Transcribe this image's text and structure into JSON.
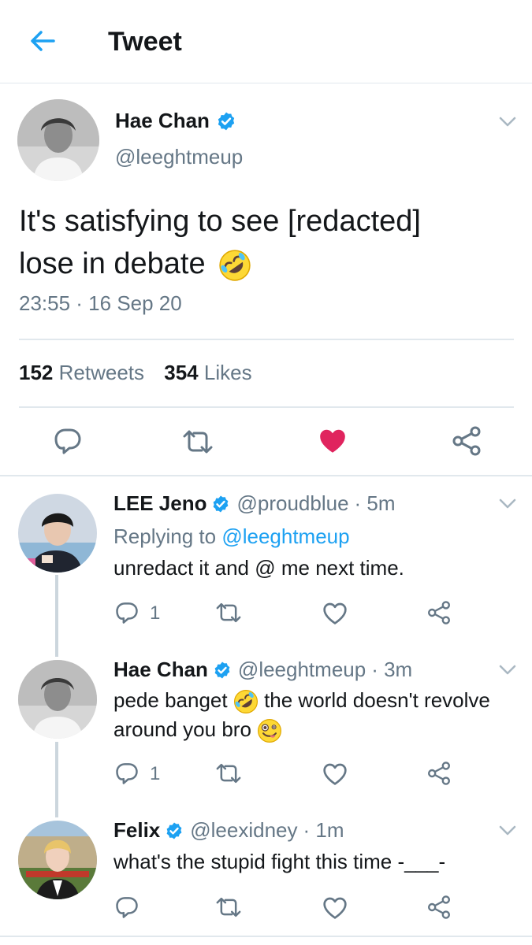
{
  "header": {
    "title": "Tweet"
  },
  "main_tweet": {
    "name": "Hae Chan",
    "handle": "@leeghtmeup",
    "text_line1": "It's satisfying to see [redacted]",
    "text_line2": "lose in debate",
    "time": "23:55 · 16 Sep 20",
    "retweets_count": "152",
    "retweets_label": "Retweets",
    "likes_count": "354",
    "likes_label": "Likes",
    "liked": true
  },
  "replies": [
    {
      "name": "LEE Jeno",
      "handle": "@proudblue",
      "age": "· 5m",
      "replying_prefix": "Replying to",
      "replying_to": "@leeghtmeup",
      "text": "unredact it and @ me next time.",
      "reply_count": "1"
    },
    {
      "name": "Hae Chan",
      "handle": "@leeghtmeup",
      "age": "· 3m",
      "text_part1": "pede banget",
      "text_part2": "the world doesn't revolve",
      "text_line2": "around you bro",
      "reply_count": "1"
    },
    {
      "name": "Felix",
      "handle": "@leexidney",
      "age": "· 1m",
      "text": "what's the stupid fight this time -___-"
    }
  ],
  "colors": {
    "accent": "#1da1f2",
    "like": "#e0245e",
    "secondary_text": "#657786",
    "divider": "#e1e8ed"
  },
  "icons": {
    "back": "arrow-left-icon",
    "verified": "verified-badge-icon",
    "reply": "speech-bubble-icon",
    "retweet": "retweet-arrows-icon",
    "like": "heart-icon",
    "share": "share-nodes-icon",
    "menu": "chevron-down-icon"
  }
}
